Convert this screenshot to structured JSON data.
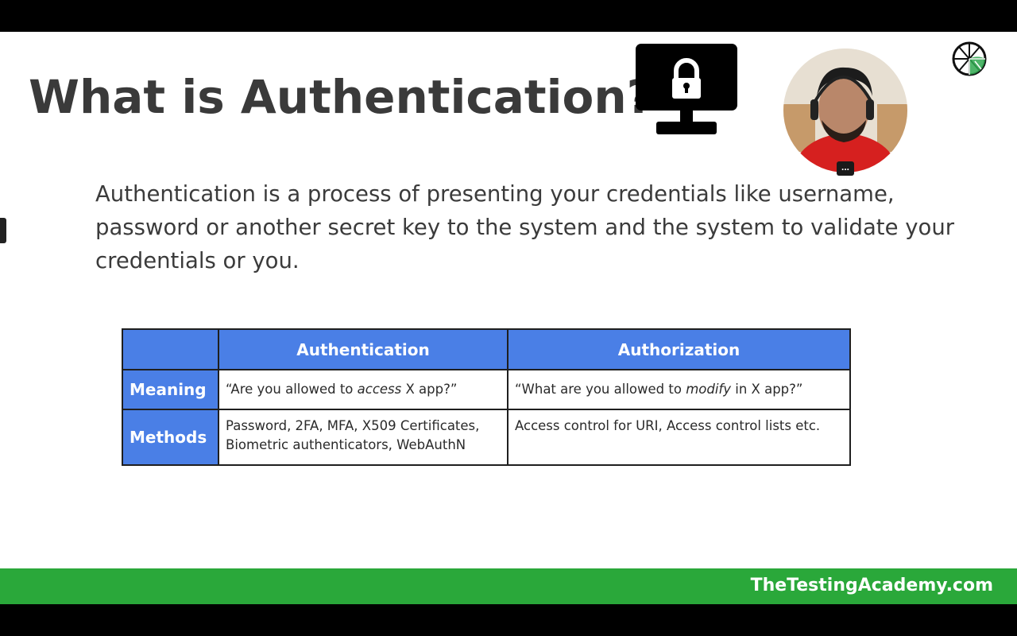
{
  "slide": {
    "title": "What is Authentication?",
    "definition": "Authentication is a process of presenting your credentials like username, password or another secret key to the system and the system to validate your credentials or you."
  },
  "table": {
    "headers": [
      "Authentication",
      "Authorization"
    ],
    "rows": [
      {
        "label": "Meaning",
        "authentication": {
          "pre": "“Are you allowed to ",
          "em": "access",
          "post": " X app?”"
        },
        "authorization": {
          "pre": "“What are you allowed to ",
          "em": "modify",
          "post": " in X app?”"
        }
      },
      {
        "label": "Methods",
        "authentication": "Password, 2FA, MFA, X509 Certificates, Biometric authenticators, WebAuthN",
        "authorization": "Access control for URI, Access control lists etc."
      }
    ]
  },
  "icons": {
    "monitor": "monitor-lock-icon",
    "globe": "globe-logo-icon",
    "webcam_menu": "more-options-icon"
  },
  "webcam": {
    "menu_label": "..."
  },
  "footer": {
    "brand": "TheTestingAcademy.com"
  },
  "colors": {
    "table_header": "#4a7fe6",
    "footer_bar": "#2aa83a",
    "frame": "#000000"
  }
}
